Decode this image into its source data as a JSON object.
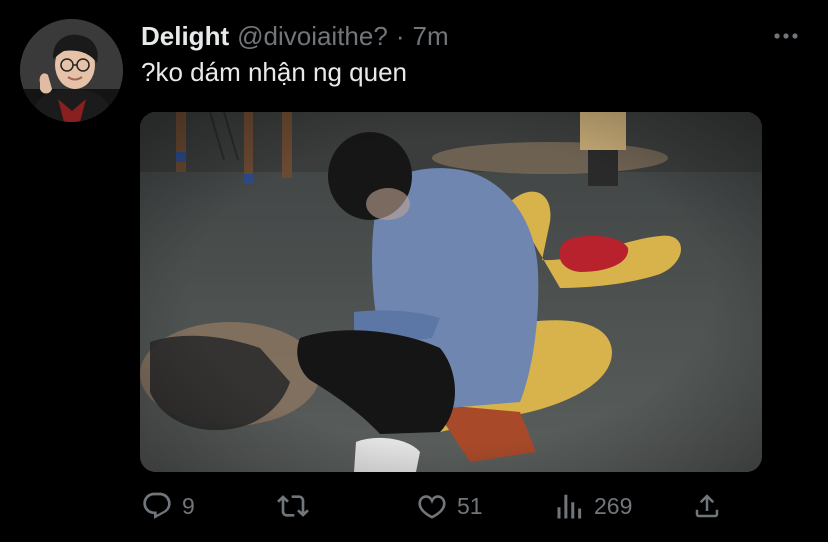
{
  "tweet": {
    "display_name": "Delight",
    "handle": "@divoiaithe?",
    "separator": "·",
    "timestamp": "7m",
    "text": "?ko dám nhận ng quen",
    "avatar_icon": "profile-photo",
    "media_icon": "playground-photo"
  },
  "actions": {
    "reply": {
      "icon": "reply-icon",
      "count": "9"
    },
    "retweet": {
      "icon": "retweet-icon",
      "count": ""
    },
    "like": {
      "icon": "heart-icon",
      "count": "51"
    },
    "views": {
      "icon": "views-icon",
      "count": "269"
    },
    "share": {
      "icon": "share-icon"
    }
  },
  "colors": {
    "background": "#000000",
    "text_primary": "#e7e9ea",
    "text_secondary": "#71767b"
  }
}
